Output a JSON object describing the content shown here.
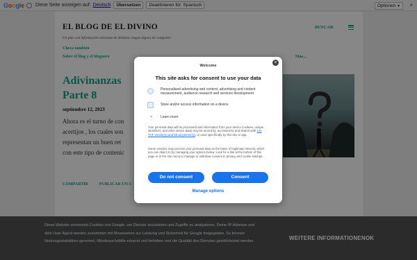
{
  "translate_bar": {
    "logo_letters": [
      "G",
      "o",
      "o",
      "g",
      "l",
      "e"
    ],
    "message": "Diese Seite anzeigen auf:",
    "language_link": "Deutsch",
    "translate_button": "Übersetzen",
    "disable_button": "Deaktivieren für: Spanisch",
    "options_button": "Optionen",
    "options_arrow": "▼",
    "close_glyph": "×"
  },
  "blog": {
    "title": "EL BLOG DE EL DIVINO",
    "search_label": "BUSCAR",
    "tagline": "Un plus con información relevante de distintos rasgos dignos de compartir",
    "nav_items": [
      "Checa tambien",
      "Sobre el blog y el bloguero"
    ],
    "nav_more": "Mas...",
    "post": {
      "title_line1": "Adivinanzas",
      "title_line2": "Parte 8",
      "date": "septiembre 12, 2023",
      "body_lines": [
        "Ahora es el turno de con",
        "acertijos , los cuales son",
        "representan un buen ret",
        "con este tipo de contenic"
      ],
      "actions": [
        "COMPARTIR",
        "PUBLICAR UN C"
      ]
    }
  },
  "consent": {
    "welcome": "Welcome",
    "title": "This site asks for consent to use your data",
    "purposes": [
      "Personalised advertising and content, advertising and content measurement, audience research and services development",
      "Store and/or access information on a device"
    ],
    "learn_more": "Learn more",
    "paragraph1_before": "Your personal data will be processed and information from your device (cookies, unique identifiers, and other device data) may be stored by, accessed by and shared with ",
    "paragraph1_link": "142 TCF vendor(s) and 68 ad partner(s)",
    "paragraph1_after": ", or used specifically by this site or app.",
    "paragraph2": "Some vendors may process your personal data on the basis of legitimate interest, which you can object to by managing your options below. Look for a link at the bottom of this page or in the site menu to manage or withdraw consent in privacy and cookie settings.",
    "do_not_consent": "Do not consent",
    "consent": "Consent",
    "manage_options": "Manage options",
    "close_glyph": "×",
    "chevron_glyph": "⌄"
  },
  "cookie_bar": {
    "text": "Diese Website verwendet Cookies von Google, um Dienste anzubieten und Zugriffe zu analysieren. Deine IP-Adresse und dein User-Agent werden zusammen mit Messwerten zur Leistung und Sicherheit für Google freigegeben. So können Nutzungsstatistiken generiert, Missbrauchsfälle erkannt und behoben und die Qualität des Dienstes gewährleistet werden.",
    "more_info": "WEITERE INFORMATIONEN",
    "ok": "OK"
  },
  "colors": {
    "accent": "#16a085",
    "primary_button": "#1a73e8",
    "cookie_bar": "#2b2b2b"
  }
}
